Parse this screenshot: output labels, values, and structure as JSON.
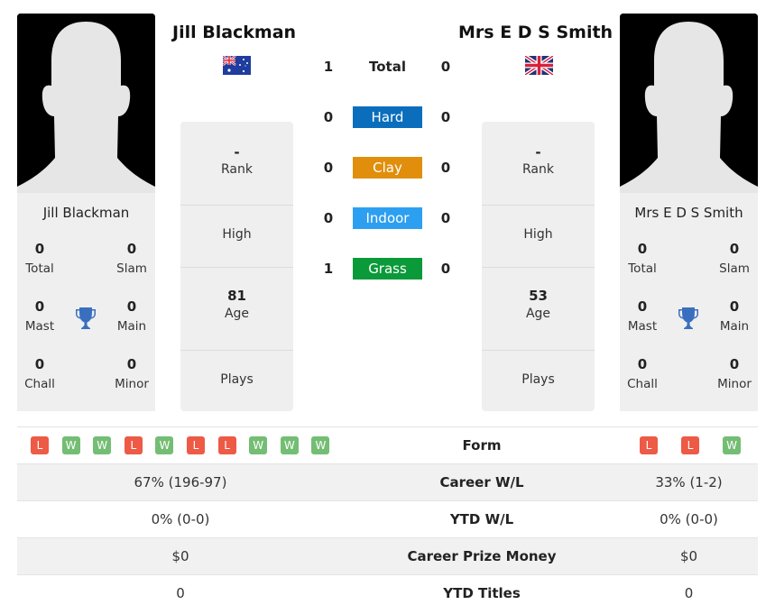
{
  "players": {
    "left": {
      "name": "Jill Blackman",
      "country": "Australia",
      "flag_icon": "australia-flag-icon",
      "card": {
        "name": "Jill Blackman",
        "total": {
          "value": "0",
          "label": "Total"
        },
        "slam": {
          "value": "0",
          "label": "Slam"
        },
        "mast": {
          "value": "0",
          "label": "Mast"
        },
        "main": {
          "value": "0",
          "label": "Main"
        },
        "chall": {
          "value": "0",
          "label": "Chall"
        },
        "minor": {
          "value": "0",
          "label": "Minor"
        }
      },
      "rank": {
        "value": "-",
        "label": "Rank"
      },
      "high": {
        "value": "",
        "label": "High"
      },
      "age": {
        "value": "81",
        "label": "Age"
      },
      "plays": {
        "value": "",
        "label": "Plays"
      },
      "form": [
        "L",
        "W",
        "W",
        "L",
        "W",
        "L",
        "L",
        "W",
        "W",
        "W"
      ]
    },
    "right": {
      "name": "Mrs E D S Smith",
      "country": "United Kingdom",
      "flag_icon": "uk-flag-icon",
      "card": {
        "name": "Mrs E D S Smith",
        "total": {
          "value": "0",
          "label": "Total"
        },
        "slam": {
          "value": "0",
          "label": "Slam"
        },
        "mast": {
          "value": "0",
          "label": "Mast"
        },
        "main": {
          "value": "0",
          "label": "Main"
        },
        "chall": {
          "value": "0",
          "label": "Chall"
        },
        "minor": {
          "value": "0",
          "label": "Minor"
        }
      },
      "rank": {
        "value": "-",
        "label": "Rank"
      },
      "high": {
        "value": "",
        "label": "High"
      },
      "age": {
        "value": "53",
        "label": "Age"
      },
      "plays": {
        "value": "",
        "label": "Plays"
      },
      "form": [
        "L",
        "L",
        "W"
      ]
    }
  },
  "h2h": [
    {
      "label": "Total",
      "left": "1",
      "right": "0",
      "color": ""
    },
    {
      "label": "Hard",
      "left": "0",
      "right": "0",
      "color": "#0a6ebd"
    },
    {
      "label": "Clay",
      "left": "0",
      "right": "0",
      "color": "#e08e0b"
    },
    {
      "label": "Indoor",
      "left": "0",
      "right": "0",
      "color": "#2d9ff0"
    },
    {
      "label": "Grass",
      "left": "1",
      "right": "0",
      "color": "#0b9a3a"
    }
  ],
  "comparison": [
    {
      "label": "Form",
      "left": "",
      "right": ""
    },
    {
      "label": "Career W/L",
      "left": "67% (196-97)",
      "right": "33% (1-2)"
    },
    {
      "label": "YTD W/L",
      "left": "0% (0-0)",
      "right": "0% (0-0)"
    },
    {
      "label": "Career Prize Money",
      "left": "$0",
      "right": "$0"
    },
    {
      "label": "YTD Titles",
      "left": "0",
      "right": "0"
    }
  ],
  "colors": {
    "loss": "#ed5a46",
    "win": "#74bd74",
    "trophy": "#3a6fbf"
  }
}
